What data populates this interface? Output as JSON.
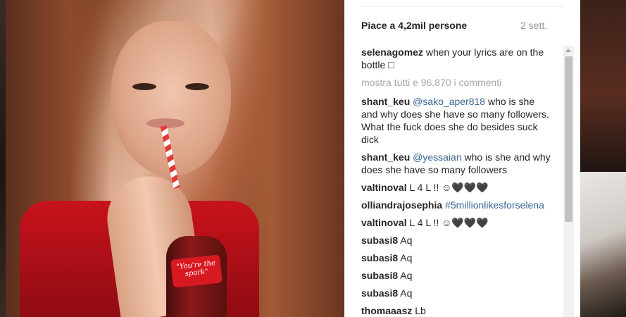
{
  "post": {
    "likes": "Piace a 4,2mil persone",
    "timestamp": "2 sett."
  },
  "caption": {
    "user": "selenagomez",
    "text": " when your lyrics are on the bottle □"
  },
  "show_all_comments": "mostra tutti e 96.870 i commenti",
  "photo": {
    "bottle_label": "\"You're the spark\""
  },
  "comments": [
    {
      "user": "shant_keu",
      "mention": "@sako_aper818",
      "text": " who is she and why does she have so many followers. What the fuck does she do besides suck dick"
    },
    {
      "user": "shant_keu",
      "mention": "@yessaian",
      "text": " who is she and why does she have so many followers"
    },
    {
      "user": "valtinoval",
      "mention": "",
      "text": " L 4 L !! ☺🖤🖤🖤"
    },
    {
      "user": "olliandrajosephia",
      "mention": "#5millionlikesforselena",
      "text": ""
    },
    {
      "user": "valtinoval",
      "mention": "",
      "text": " L 4 L !! ☺🖤🖤🖤"
    },
    {
      "user": "subasi8",
      "mention": "",
      "text": " Aq"
    },
    {
      "user": "subasi8",
      "mention": "",
      "text": " Aq"
    },
    {
      "user": "subasi8",
      "mention": "",
      "text": " Aq"
    },
    {
      "user": "subasi8",
      "mention": "",
      "text": " Aq"
    },
    {
      "user": "thomaaasz",
      "mention": "",
      "text": " Lb"
    }
  ]
}
